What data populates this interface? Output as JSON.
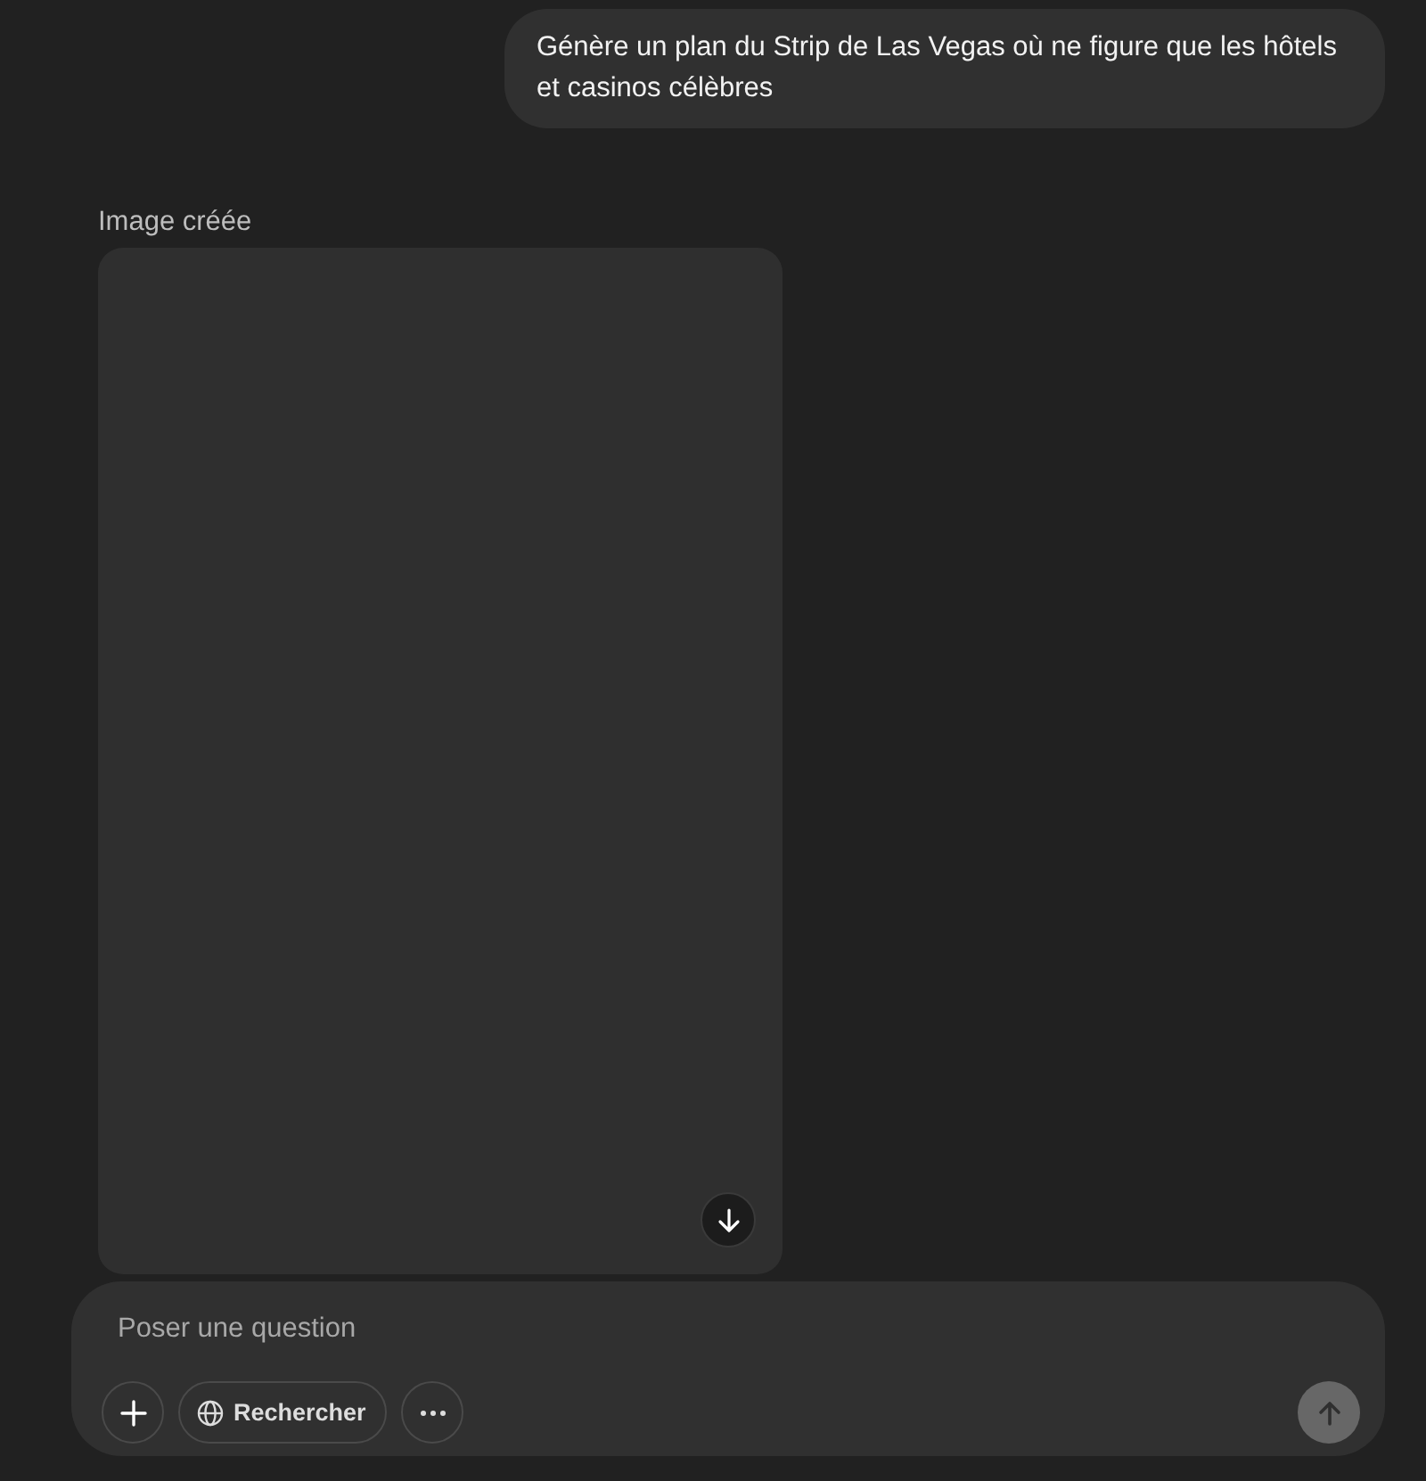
{
  "user_message": {
    "text": "Génère un plan du Strip de Las Vegas où ne figure que les hôtels et casinos célèbres"
  },
  "assistant": {
    "status": "Image créée",
    "image": {
      "loading": true
    }
  },
  "composer": {
    "placeholder": "Poser une question",
    "tools": [
      {
        "kind": "add"
      },
      {
        "kind": "search",
        "label": "Rechercher"
      },
      {
        "kind": "more"
      }
    ],
    "send_disabled": true
  }
}
